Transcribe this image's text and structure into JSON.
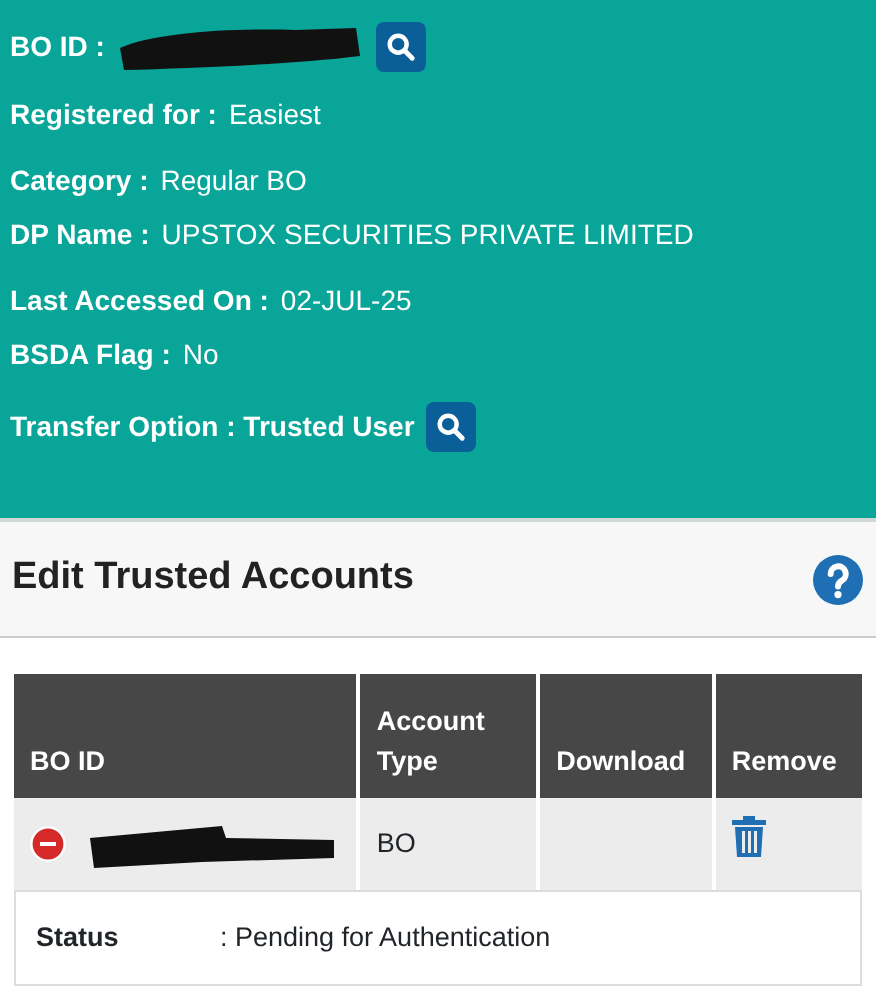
{
  "details": [
    {
      "kind": "redacted",
      "label": "BO ID :"
    },
    {
      "kind": "text",
      "label": "Registered for :",
      "value": "Easiest"
    },
    {
      "kind": "text",
      "label": "Category :",
      "value": "Regular BO"
    },
    {
      "kind": "text",
      "label": "DP Name :",
      "value": "UPSTOX SECURITIES PRIVATE LIMITED"
    },
    {
      "kind": "text",
      "label": "Last Accessed On :",
      "value": "02-JUL-25"
    },
    {
      "kind": "text",
      "label": "BSDA Flag :",
      "value": "No"
    },
    {
      "kind": "search",
      "label": "Transfer Option : Trusted User"
    }
  ],
  "section": {
    "title": "Edit Trusted Accounts"
  },
  "table": {
    "columns": [
      "BO ID",
      "Account Type",
      "Download",
      "Remove"
    ],
    "rows": [
      {
        "account_type": "BO",
        "status_label": "Status",
        "status_value": ": Pending for Authentication"
      }
    ]
  }
}
